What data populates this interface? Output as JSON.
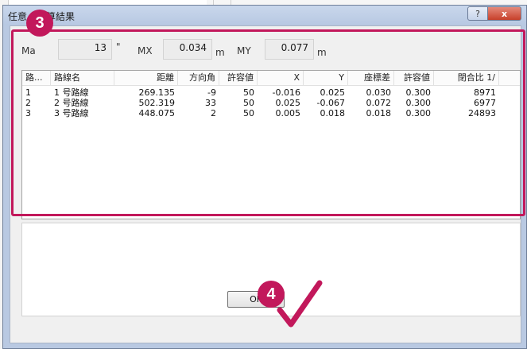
{
  "dialog": {
    "title": "任意　計算結果",
    "help_label": "?",
    "close_label": "x"
  },
  "stats": {
    "ma_label": "Ma",
    "ma_value": "13",
    "ma_unit": "\"",
    "mx_label": "MX",
    "mx_value": "0.034",
    "mx_unit": "m",
    "my_label": "MY",
    "my_value": "0.077",
    "my_unit": "m"
  },
  "table": {
    "headers": [
      "路...",
      "路線名",
      "距離",
      "方向角",
      "許容値",
      "X",
      "Y",
      "座標差",
      "許容値",
      "閉合比 1/"
    ],
    "rows": [
      [
        "1",
        "1 号路線",
        "269.135",
        "-9",
        "50",
        "-0.016",
        "0.025",
        "0.030",
        "0.300",
        "8971"
      ],
      [
        "2",
        "2 号路線",
        "502.319",
        "33",
        "50",
        "0.025",
        "-0.067",
        "0.072",
        "0.300",
        "6977"
      ],
      [
        "3",
        "3 号路線",
        "448.075",
        "2",
        "50",
        "0.005",
        "0.018",
        "0.018",
        "0.300",
        "24893"
      ]
    ]
  },
  "buttons": {
    "ok_label": "OK"
  },
  "annotations": {
    "marker_3": "3",
    "marker_4": "4",
    "accent_color": "#c2185b"
  }
}
